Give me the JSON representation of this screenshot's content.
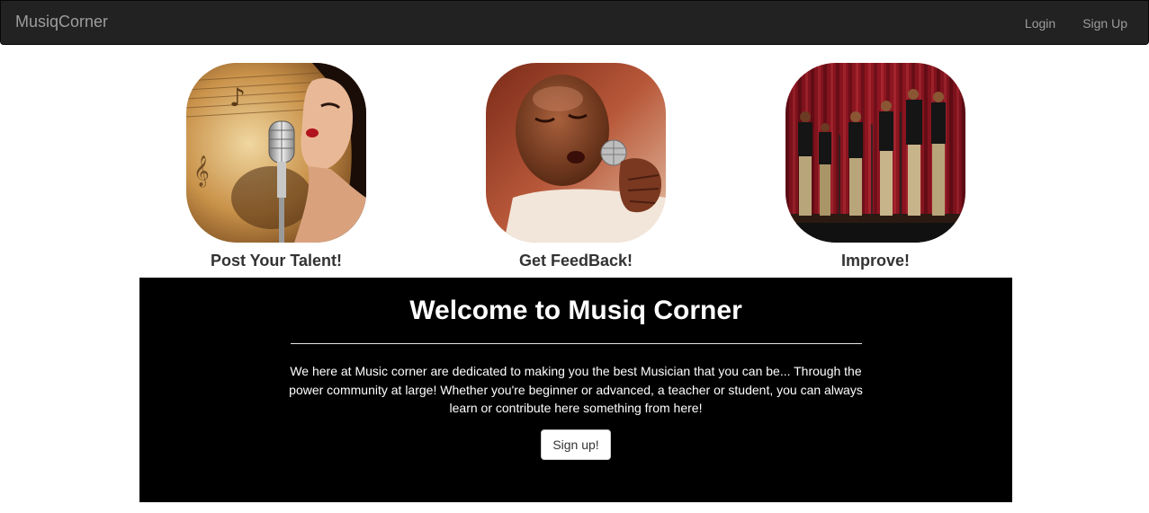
{
  "navbar": {
    "brand": "MusiqCorner",
    "links": [
      {
        "label": "Login"
      },
      {
        "label": "Sign Up"
      }
    ]
  },
  "features": [
    {
      "caption": "Post Your Talent!",
      "image": "singer-with-microphone-photo"
    },
    {
      "caption": "Get FeedBack!",
      "image": "man-singing-into-microphone-photo"
    },
    {
      "caption": "Improve!",
      "image": "group-performing-on-stage-photo"
    }
  ],
  "jumbotron": {
    "title": "Welcome to Musiq Corner",
    "body": "We here at Music corner are dedicated to making you the best Musician that you can be... Through the power community at large! Whether you're beginner or advanced, a teacher or student, you can always learn or contribute here something from here!",
    "button_label": "Sign up!"
  },
  "colors": {
    "navbar_bg": "#222222",
    "navbar_text": "#9d9d9d",
    "jumbotron_bg": "#000000",
    "caption_text": "#333333"
  }
}
